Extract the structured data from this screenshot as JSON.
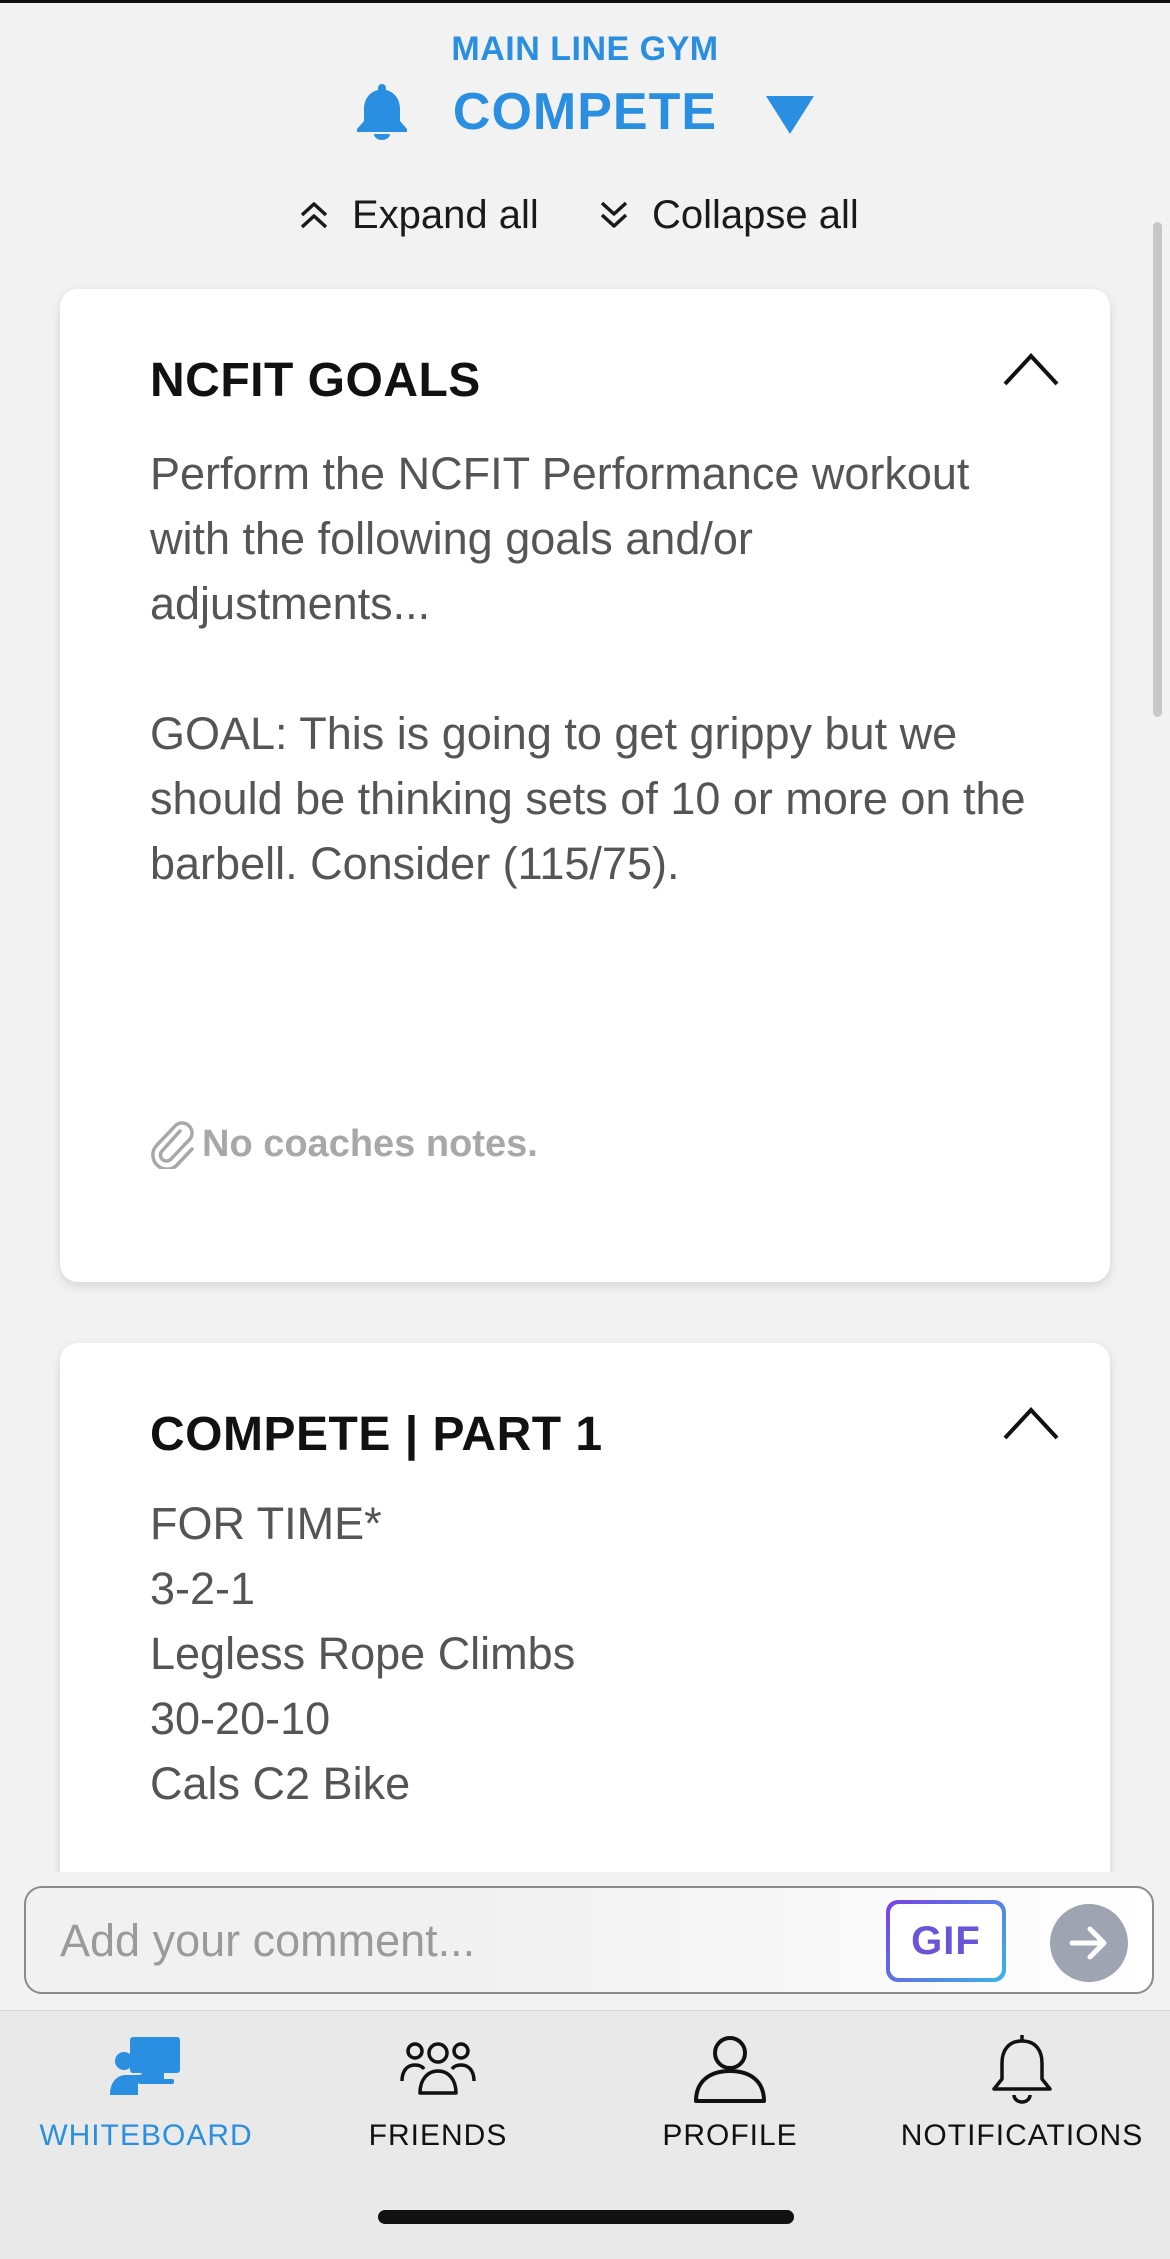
{
  "header": {
    "gym_name": "MAIN LINE GYM",
    "program": "COMPETE",
    "accent_color": "#2a8fe0",
    "bell_icon": "bell-icon",
    "dropdown_icon": "triangle-down-icon"
  },
  "controls": {
    "expand_all": "Expand all",
    "collapse_all": "Collapse all"
  },
  "cards": [
    {
      "title": "NCFIT GOALS",
      "body": "Perform the NCFIT Performance workout with the following goals and/or adjustments...\n\nGOAL: This is going to get grippy but we should be thinking sets of 10 or more on the barbell. Consider (115/75).",
      "coach_notes": "No coaches notes.",
      "expanded": true
    },
    {
      "title": "COMPETE | PART 1",
      "body": "FOR TIME*\n3-2-1\nLegless Rope Climbs\n30-20-10\nCals C2 Bike",
      "expanded": true
    }
  ],
  "comment": {
    "placeholder": "Add your comment...",
    "gif_label": "GIF"
  },
  "nav": {
    "items": [
      {
        "label": "WHITEBOARD",
        "icon": "whiteboard-icon",
        "active": true
      },
      {
        "label": "FRIENDS",
        "icon": "friends-icon",
        "active": false
      },
      {
        "label": "PROFILE",
        "icon": "profile-icon",
        "active": false
      },
      {
        "label": "NOTIFICATIONS",
        "icon": "bell-icon",
        "active": false
      }
    ]
  }
}
